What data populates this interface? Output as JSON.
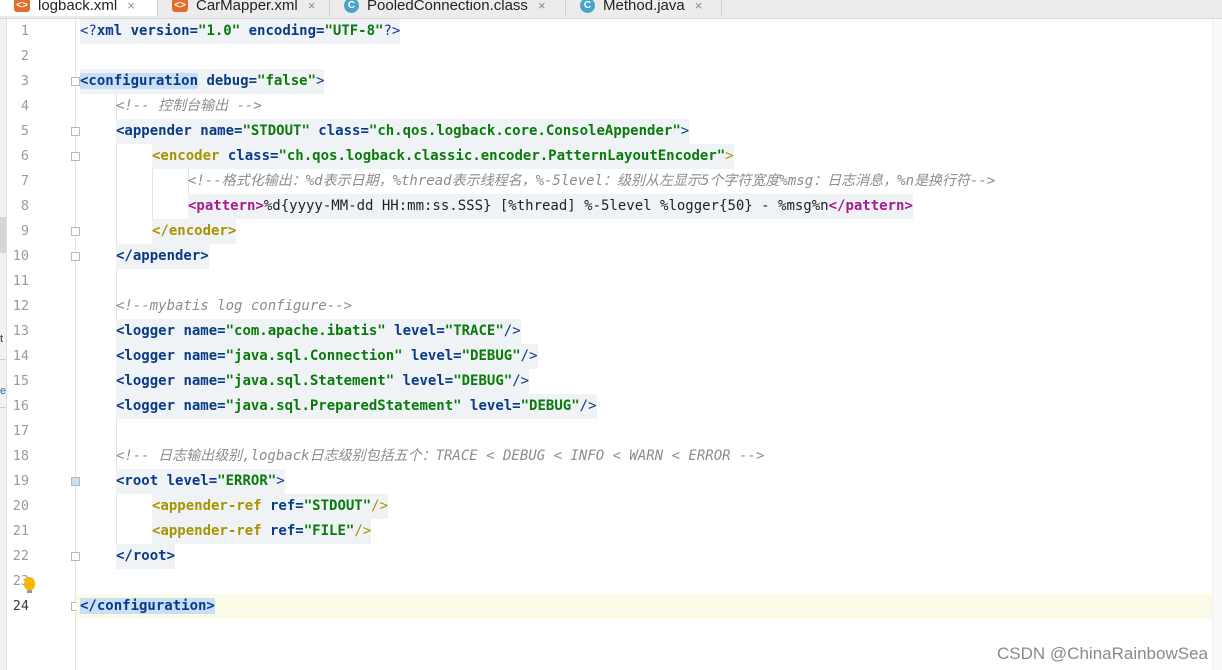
{
  "tabs": [
    {
      "label": "logback.xml",
      "icon": "xml-file-icon",
      "active": true
    },
    {
      "label": "CarMapper.xml",
      "icon": "xml-file-icon",
      "active": false
    },
    {
      "label": "PooledConnection.class",
      "icon": "class-file-icon",
      "active": false
    },
    {
      "label": "Method.java",
      "icon": "class-file-icon",
      "active": false
    }
  ],
  "close_glyph": "×",
  "line_numbers": [
    "1",
    "2",
    "3",
    "4",
    "5",
    "6",
    "7",
    "8",
    "9",
    "10",
    "11",
    "12",
    "13",
    "14",
    "15",
    "16",
    "17",
    "18",
    "19",
    "20",
    "21",
    "22",
    "23",
    "24"
  ],
  "code": {
    "l1_a": "<?",
    "l1_b": "xml",
    "l1_c": " version=",
    "l1_d": "\"1.0\"",
    "l1_e": " encoding=",
    "l1_f": "\"UTF-8\"",
    "l1_g": "?>",
    "l3_a": "<configuration",
    "l3_b": " debug=",
    "l3_c": "\"false\"",
    "l3_d": ">",
    "l4": "<!-- 控制台输出 -->",
    "l5_a": "<appender",
    "l5_b": " name=",
    "l5_c": "\"STDOUT\"",
    "l5_d": " class=",
    "l5_e": "\"ch.qos.logback.core.ConsoleAppender\"",
    "l5_f": ">",
    "l6_a": "<encoder",
    "l6_b": " class=",
    "l6_c": "\"ch.qos.logback.classic.encoder.PatternLayoutEncoder\"",
    "l6_d": ">",
    "l7": "<!--格式化输出：%d表示日期，%thread表示线程名，%-5level：级别从左显示5个字符宽度%msg：日志消息，%n是换行符-->",
    "l8_a": "<pattern>",
    "l8_b": "%d{yyyy-MM-dd HH:mm:ss.SSS} [%thread] %-5level %logger{50} - %msg%n",
    "l8_c": "</pattern>",
    "l9": "</encoder>",
    "l10": "</appender>",
    "l12": "<!--mybatis log configure-->",
    "l13_a": "<logger",
    "l13_b": " name=",
    "l13_c": "\"com.apache.ibatis\"",
    "l13_d": " level=",
    "l13_e": "\"TRACE\"",
    "l13_f": "/>",
    "l14_a": "<logger",
    "l14_b": " name=",
    "l14_c": "\"java.sql.Connection\"",
    "l14_d": " level=",
    "l14_e": "\"DEBUG\"",
    "l14_f": "/>",
    "l15_a": "<logger",
    "l15_b": " name=",
    "l15_c": "\"java.sql.Statement\"",
    "l15_d": " level=",
    "l15_e": "\"DEBUG\"",
    "l15_f": "/>",
    "l16_a": "<logger",
    "l16_b": " name=",
    "l16_c": "\"java.sql.PreparedStatement\"",
    "l16_d": " level=",
    "l16_e": "\"DEBUG\"",
    "l16_f": "/>",
    "l18": "<!-- 日志输出级别,logback日志级别包括五个：TRACE < DEBUG < INFO < WARN < ERROR -->",
    "l19_a": "<root",
    "l19_b": " level=",
    "l19_c": "\"ERROR\"",
    "l19_d": ">",
    "l20_a": "<appender-ref",
    "l20_b": " ref=",
    "l20_c": "\"STDOUT\"",
    "l20_d": "/>",
    "l21_a": "<appender-ref",
    "l21_b": " ref=",
    "l21_c": "\"FILE\"",
    "l21_d": "/>",
    "l22": "</root>",
    "l24": "</configuration>"
  },
  "left_panel": {
    "text1": "t",
    "text2": "e"
  },
  "watermark": "CSDN @ChinaRainbowSea"
}
